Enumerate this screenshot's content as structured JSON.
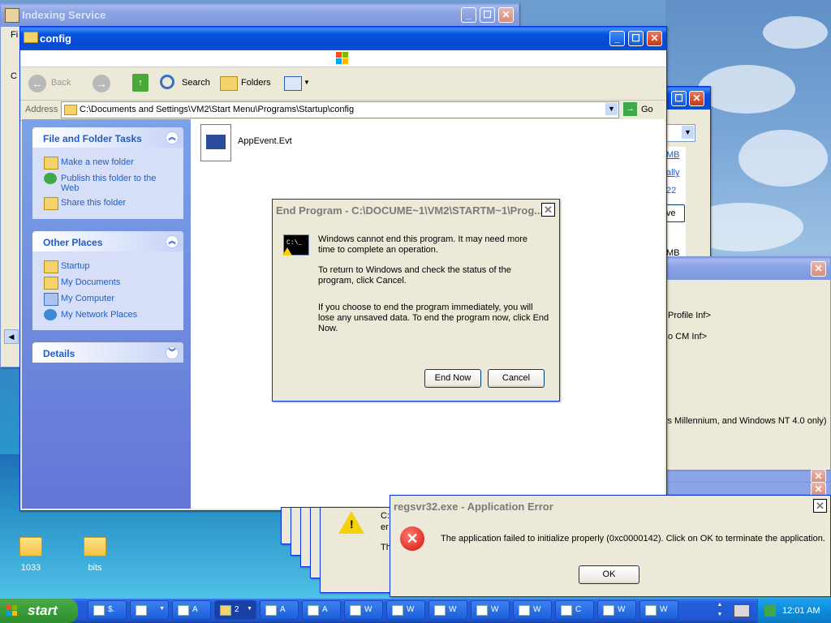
{
  "desktop": {
    "icons": [
      {
        "label": "1033"
      },
      {
        "label": "bits"
      }
    ]
  },
  "indexing": {
    "title": "Indexing Service",
    "menu_peek": "Fi",
    "side_peek": "C"
  },
  "config": {
    "title": "config",
    "toolbar": {
      "back": "Back",
      "search": "Search",
      "folders": "Folders"
    },
    "address": {
      "label": "Address",
      "path": "C:\\Documents and Settings\\VM2\\Start Menu\\Programs\\Startup\\config",
      "go": "Go"
    },
    "tasks": {
      "title": "File and Folder Tasks",
      "items": [
        "Make a new folder",
        "Publish this folder to the Web",
        "Share this folder"
      ]
    },
    "places": {
      "title": "Other Places",
      "items": [
        "Startup",
        "My Documents",
        "My Computer",
        "My Network Places"
      ]
    },
    "details": {
      "title": "Details"
    },
    "file": {
      "name": "AppEvent.Evt"
    }
  },
  "bg_window": {
    "links": [
      "MB",
      "ally",
      "22",
      "ve",
      "MB"
    ]
  },
  "inf_window": {
    "lines": [
      "Profile Inf>",
      "o CM Inf>",
      "vs Millennium, and Windows NT 4.0 only)"
    ]
  },
  "end_program": {
    "title": "End Program - C:\\DOCUME~1\\VM2\\STARTM~1\\Prog...",
    "console_text": "C:\\_",
    "p1": "Windows cannot end this program. It may need more time to complete an operation.",
    "p2": "To return to Windows and check the status of the program, click Cancel.",
    "p3": "If you choose to end the program immediately, you will lose any unsaved data. To end the program now, click End Now.",
    "end_now": "End Now",
    "cancel": "Cancel"
  },
  "warn_stack": {
    "peek1": "C:",
    "peek2": "er",
    "peek3": "Th"
  },
  "app_error": {
    "title": "regsvr32.exe - Application Error",
    "message": "The application failed to initialize properly (0xc0000142). Click on OK to terminate the application.",
    "ok": "OK"
  },
  "taskbar": {
    "start": "start",
    "clock": "12:01 AM",
    "buttons": [
      "$.",
      "",
      "A",
      "2",
      "A",
      "A",
      "W",
      "W",
      "W",
      "W",
      "W",
      "C",
      "W",
      "W"
    ]
  },
  "colors": {
    "xp_blue": "#0a54e0",
    "panel_link": "#215dc6",
    "taskbar": "#245edb",
    "tray": "#0f8fdd",
    "start": "#3c9f3c"
  }
}
